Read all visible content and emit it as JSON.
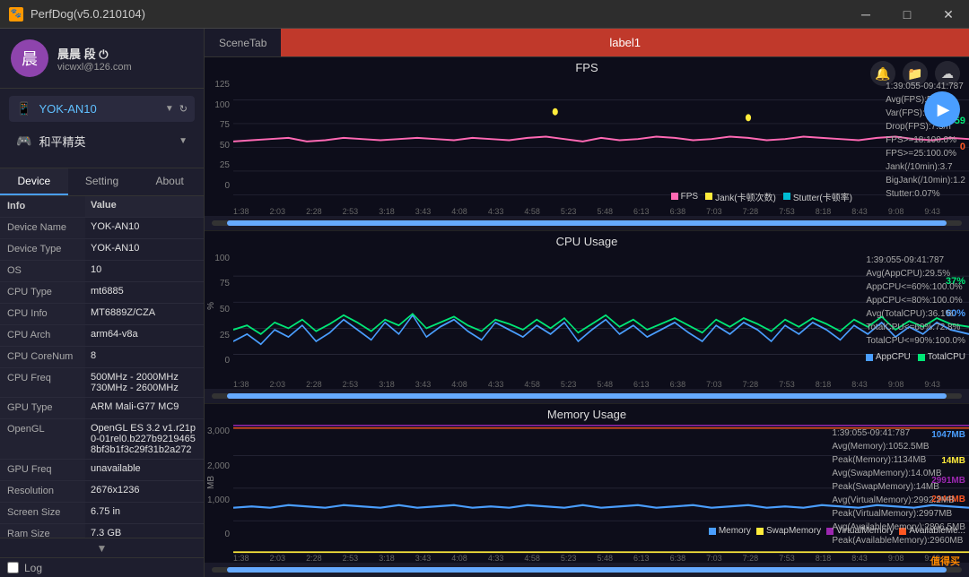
{
  "titlebar": {
    "icon": "🐶",
    "title": "PerfDog(v5.0.210104)",
    "min_btn": "─",
    "max_btn": "□",
    "close_btn": "✕"
  },
  "sidebar": {
    "user": {
      "name": "晨晨 段 ⏻",
      "email": "vicwxl@126.com"
    },
    "device": "YOK-AN10",
    "game": "和平精英",
    "tabs": [
      "Device",
      "Setting",
      "About"
    ],
    "active_tab": "Device",
    "info_header": "Info",
    "value_header": "Value",
    "rows": [
      {
        "key": "Device Name",
        "val": "YOK-AN10"
      },
      {
        "key": "Device Type",
        "val": "YOK-AN10"
      },
      {
        "key": "OS",
        "val": "10"
      },
      {
        "key": "CPU Type",
        "val": "mt6885"
      },
      {
        "key": "CPU Info",
        "val": "MT6889Z/CZA"
      },
      {
        "key": "CPU Arch",
        "val": "arm64-v8a"
      },
      {
        "key": "CPU CoreNum",
        "val": "8"
      },
      {
        "key": "CPU Freq",
        "val": "500MHz - 2000MHz\n730MHz - 2600MHz"
      },
      {
        "key": "GPU Type",
        "val": "ARM Mali-G77 MC9"
      },
      {
        "key": "OpenGL",
        "val": "OpenGL ES 3.2 v1.r21p0-01rel0.b227b92194658bf3b1f3c29f31b2a272"
      },
      {
        "key": "GPU Freq",
        "val": "unavailable"
      },
      {
        "key": "Resolution",
        "val": "2676x1236"
      },
      {
        "key": "Screen Size",
        "val": "6.75 in"
      },
      {
        "key": "Ram Size",
        "val": "7.3 GB"
      }
    ],
    "log_label": "Log"
  },
  "content": {
    "scene_tab_label": "SceneTab",
    "label1": "label1",
    "top_icons": [
      "🔔",
      "📁",
      "☁"
    ],
    "fps_chart": {
      "title": "FPS",
      "y_labels": [
        "125",
        "100",
        "75",
        "50",
        "25",
        "0"
      ],
      "x_labels": [
        "1:38",
        "2:03",
        "2:28",
        "2:53",
        "3:18",
        "3:43",
        "4:08",
        "4:33",
        "4:58",
        "5:23",
        "5:48",
        "6:13",
        "6:38",
        "7:03",
        "7:28",
        "7:53",
        "8:18",
        "8:43",
        "9:08",
        "9:43"
      ],
      "info_time": "1:39:055-09:41:787",
      "avg_fps": "Avg(FPS):59.3",
      "var_fps": "Var(FPS):1.73",
      "drop_fps": "Drop(FPS):7.5/h",
      "fps_pct": "FPS>=18:100.0%",
      "fps_pct2": "FPS>=25:100.0%",
      "jank": "Jank(/10min):3.7",
      "bigjank": "BigJank(/10min):1.2",
      "stutter": "Stutter:0.07%",
      "val_right1": "59",
      "val_right2": "0",
      "legend": [
        "FPS",
        "Jank(卡顿次数)",
        "Stutter(卡顿率)"
      ],
      "legend_colors": [
        "#ff69b4",
        "#ffeb3b",
        "#00bcd4"
      ]
    },
    "cpu_chart": {
      "title": "CPU Usage",
      "y_labels": [
        "100",
        "75",
        "50",
        "25",
        "0"
      ],
      "x_labels": [
        "1:38",
        "2:03",
        "2:28",
        "2:53",
        "3:18",
        "3:43",
        "4:08",
        "4:33",
        "4:58",
        "5:23",
        "5:48",
        "6:13",
        "6:38",
        "7:03",
        "7:28",
        "7:53",
        "8:18",
        "8:43",
        "9:08",
        "9:43"
      ],
      "info_time": "1:39:055-09:41:787",
      "avg_app": "Avg(AppCPU):29.5%",
      "app_le60": "AppCPU<=60%:100.0%",
      "app_le80": "AppCPU<=80%:100.0%",
      "avg_total": "Avg(TotalCPU):36.1%",
      "total_le60": "TotalCPU<=60%:72.8%",
      "total_le90": "TotalCPU<=90%:100.0%",
      "val_right1": "37%",
      "val_right2": "60%",
      "legend": [
        "AppCPU",
        "TotalCPU"
      ],
      "legend_colors": [
        "#4a9eff",
        "#00e676"
      ]
    },
    "mem_chart": {
      "title": "Memory Usage",
      "y_labels": [
        "3,000",
        "2,000",
        "1,000",
        "0"
      ],
      "x_labels": [
        "1:38",
        "2:03",
        "2:28",
        "2:53",
        "3:18",
        "3:43",
        "4:08",
        "4:33",
        "4:58",
        "5:23",
        "5:48",
        "6:13",
        "6:38",
        "7:03",
        "7:28",
        "7:53",
        "8:18",
        "8:43",
        "9:08",
        "9:43"
      ],
      "info_time": "1:39:055-09:41:787",
      "avg_mem": "Avg(Memory):1052.5MB",
      "peak_mem": "Peak(Memory):1134MB",
      "avg_swap": "Avg(SwapMemory):14.0MB",
      "peak_swap": "Peak(SwapMemory):14MB",
      "avg_vmem": "Avg(VirtualMemory):2992.2MB",
      "peak_vmem": "Peak(VirtualMemory):2997MB",
      "avg_avail": "Avg(AvailableMemory):2896.5MB",
      "peak_avail": "Peak(AvailableMemory):2960MB",
      "val_right1": "1047MB",
      "val_right2": "14MB",
      "val_right3": "2991MB",
      "val_right4": "2944MB",
      "legend": [
        "Memory",
        "SwapMemory",
        "VirtualMemory",
        "AvailableMe..."
      ],
      "legend_colors": [
        "#4a9eff",
        "#ffeb3b",
        "#9c27b0",
        "#ff5722"
      ]
    },
    "watermark": "值得买"
  }
}
